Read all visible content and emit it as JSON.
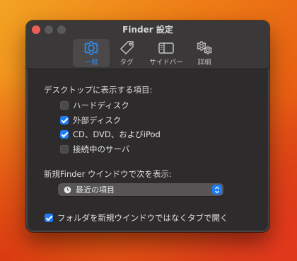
{
  "window": {
    "title": "Finder 設定"
  },
  "tabs": [
    {
      "label": "一般",
      "icon": "gear-icon",
      "active": true
    },
    {
      "label": "タグ",
      "icon": "tag-icon",
      "active": false
    },
    {
      "label": "サイドバー",
      "icon": "sidebar-icon",
      "active": false
    },
    {
      "label": "詳細",
      "icon": "gears-icon",
      "active": false
    }
  ],
  "desktop_section": {
    "title": "デスクトップに表示する項目:",
    "items": [
      {
        "label": "ハードディスク",
        "checked": false
      },
      {
        "label": "外部ディスク",
        "checked": true
      },
      {
        "label": "CD、DVD、およびiPod",
        "checked": true
      },
      {
        "label": "接続中のサーバ",
        "checked": false
      }
    ]
  },
  "new_window_section": {
    "title": "新規Finder ウインドウで次を表示:",
    "selected": "最近の項目",
    "selected_icon": "clock-icon"
  },
  "open_folders": {
    "label": "フォルダを新規ウインドウではなくタブで開く",
    "checked": true
  },
  "colors": {
    "accent": "#1f7df4",
    "window_bg": "#2d2b2c",
    "close_button": "#ec5f57"
  }
}
